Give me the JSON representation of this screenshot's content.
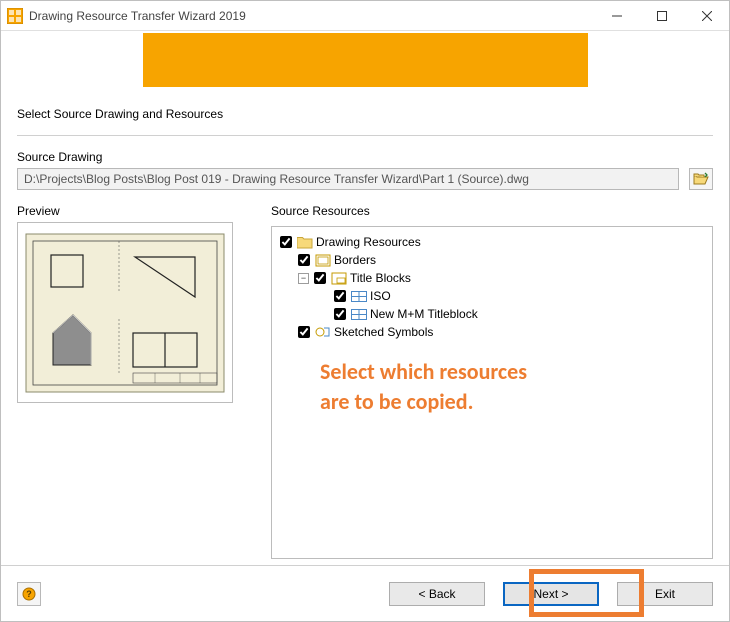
{
  "window": {
    "title": "Drawing Resource Transfer Wizard 2019"
  },
  "page": {
    "heading": "Select Source Drawing and Resources"
  },
  "source": {
    "label": "Source Drawing",
    "path": "D:\\Projects\\Blog Posts\\Blog Post 019 - Drawing Resource Transfer Wizard\\Part 1 (Source).dwg"
  },
  "preview": {
    "label": "Preview"
  },
  "resources": {
    "label": "Source Resources",
    "tree": {
      "root": "Drawing Resources",
      "borders": "Borders",
      "titleblocks": "Title Blocks",
      "tb_iso": "ISO",
      "tb_new": "New M+M Titleblock",
      "sketched": "Sketched Symbols"
    }
  },
  "annotation": {
    "line1": "Select which resources",
    "line2": "are to be copied."
  },
  "buttons": {
    "back": "< Back",
    "next": "Next >",
    "exit": "Exit"
  }
}
